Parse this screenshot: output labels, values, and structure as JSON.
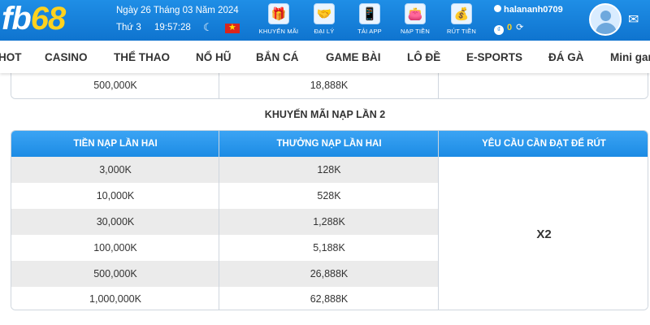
{
  "header": {
    "logo_fb": "fb",
    "logo_68": "68",
    "date": "Ngày 26 Tháng 03 Năm 2024",
    "weekday": "Thứ 3",
    "time": "19:57:28",
    "nav": [
      {
        "label": "KHUYẾN MÃI",
        "icon": "gift-icon"
      },
      {
        "label": "ĐẠI LÝ",
        "icon": "handshake-icon"
      },
      {
        "label": "TẢI APP",
        "icon": "phone-download-icon"
      },
      {
        "label": "NẠP TIỀN",
        "icon": "wallet-icon"
      },
      {
        "label": "RÚT TIỀN",
        "icon": "money-bag-icon"
      }
    ],
    "username": "halananh0709",
    "balance": "0"
  },
  "menu": [
    "HOT",
    "CASINO",
    "THỂ THAO",
    "NỔ HŨ",
    "BẮN CÁ",
    "GAME BÀI",
    "LÔ ĐỀ",
    "E-SPORTS",
    "ĐÁ GÀ",
    "Mini game"
  ],
  "top_table": {
    "row": {
      "deposit": "500,000K",
      "bonus": "18,888K",
      "req": ""
    }
  },
  "section": {
    "title": "KHUYẾN MÃI NẠP LẦN 2",
    "headers": [
      "TIỀN NẠP LẦN HAI",
      "THƯỞNG NẠP LẦN HAI",
      "YÊU CẦU CẦN ĐẠT ĐỂ RÚT"
    ],
    "rows": [
      {
        "deposit": "3,000K",
        "bonus": "128K"
      },
      {
        "deposit": "10,000K",
        "bonus": "528K"
      },
      {
        "deposit": "30,000K",
        "bonus": "1,288K"
      },
      {
        "deposit": "100,000K",
        "bonus": "5,188K"
      },
      {
        "deposit": "500,000K",
        "bonus": "26,888K"
      },
      {
        "deposit": "1,000,000K",
        "bonus": "62,888K"
      }
    ],
    "requirement": "X2"
  },
  "colors": {
    "header_blue": "#1a7fdc",
    "logo_yellow": "#ffd21e",
    "table_header": "#2a96ea",
    "row_grey": "#ebebeb"
  }
}
